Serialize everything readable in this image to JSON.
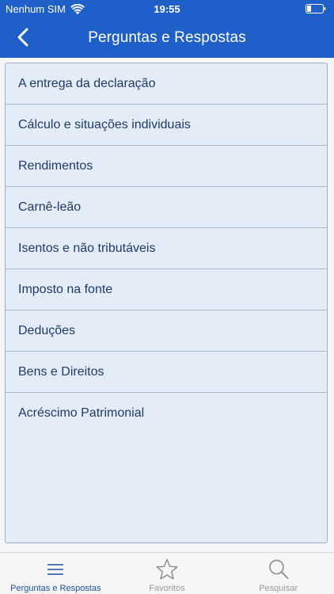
{
  "status_bar": {
    "carrier": "Nenhum SIM",
    "time": "19:55"
  },
  "nav_bar": {
    "title": "Perguntas e Respostas"
  },
  "list": {
    "items": [
      {
        "label": "A entrega da declaração"
      },
      {
        "label": "Cálculo e situações individuais"
      },
      {
        "label": "Rendimentos"
      },
      {
        "label": "Carnê-leão"
      },
      {
        "label": "Isentos e não tributáveis"
      },
      {
        "label": "Imposto na fonte"
      },
      {
        "label": "Deduções"
      },
      {
        "label": "Bens e Direitos"
      },
      {
        "label": "Acréscimo Patrimonial"
      }
    ]
  },
  "tab_bar": {
    "tabs": [
      {
        "label": "Perguntas e Respostas",
        "icon": "menu-lines-icon",
        "active": true
      },
      {
        "label": "Favoritos",
        "icon": "star-icon",
        "active": false
      },
      {
        "label": "Pesquisar",
        "icon": "search-icon",
        "active": false
      }
    ]
  },
  "colors": {
    "brand": "#1f5fc8",
    "list_background": "#e4ecf7",
    "list_text": "#1c3b68",
    "tab_active": "#1d4f9e",
    "tab_inactive": "#9a9a9a"
  }
}
